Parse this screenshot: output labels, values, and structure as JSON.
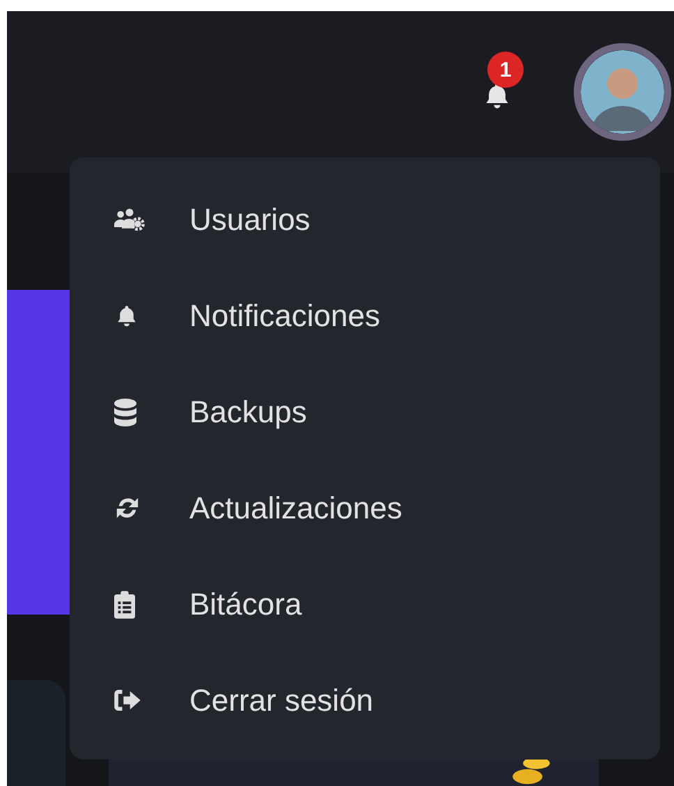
{
  "header": {
    "notification_count": "1"
  },
  "user_menu": {
    "items": [
      {
        "label": "Usuarios",
        "kind": "users"
      },
      {
        "label": "Notificaciones",
        "kind": "bell"
      },
      {
        "label": "Backups",
        "kind": "database"
      },
      {
        "label": "Actualizaciones",
        "kind": "sync"
      },
      {
        "label": "Bitácora",
        "kind": "clipboard"
      },
      {
        "label": "Cerrar sesión",
        "kind": "logout"
      }
    ]
  }
}
